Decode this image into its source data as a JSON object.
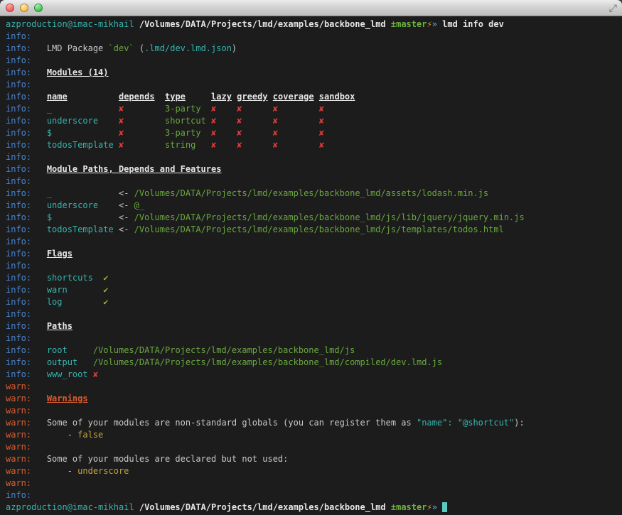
{
  "window": {
    "title": "",
    "titlebar_buttons": [
      {
        "name": "close-button"
      },
      {
        "name": "minimize-button"
      },
      {
        "name": "zoom-button"
      }
    ],
    "resize_icon": "⤢"
  },
  "colors": {
    "bg": "#1c1c1c",
    "info": "#4a85d1",
    "warn": "#dc5c2e",
    "teal": "#36b3ae",
    "green": "#69a83e",
    "check": "#93b43a",
    "red": "#dd3d3a",
    "yellow": "#c2a33a",
    "white": "#c9c9c9",
    "bright": "#e6e6e6",
    "branch": "#6db43f",
    "bolt": "#e2a43c",
    "arrow": "#46a0d0",
    "cursor": "#5bc8c2"
  },
  "terminal": {
    "lines": [
      {
        "name": "prompt-line",
        "segments": [
          {
            "t": "azproduction@imac-mikhail",
            "c": "teal",
            "n": "prompt-user-host"
          },
          {
            "t": " "
          },
          {
            "t": "/Volumes/DATA/Projects/lmd/examples/backbone_lmd",
            "c": "bright",
            "b": true,
            "n": "prompt-cwd"
          },
          {
            "t": " "
          },
          {
            "t": "±master",
            "c": "branch",
            "b": true,
            "n": "git-branch"
          },
          {
            "t": "⚡",
            "c": "bolt",
            "n": "git-dirty-icon"
          },
          {
            "t": "»",
            "c": "arrow",
            "b": true,
            "n": "prompt-arrow"
          },
          {
            "t": " "
          },
          {
            "t": "lmd info dev",
            "c": "bright",
            "b": true,
            "n": "command"
          }
        ]
      },
      {
        "name": "output-line",
        "segments": [
          {
            "t": "info:",
            "c": "info"
          }
        ]
      },
      {
        "name": "output-line",
        "segments": [
          {
            "t": "info:",
            "c": "info"
          },
          {
            "t": "   "
          },
          {
            "t": "LMD Package "
          },
          {
            "t": "`dev`",
            "c": "green"
          },
          {
            "t": " ("
          },
          {
            "t": ".lmd/dev.lmd.json",
            "c": "teal"
          },
          {
            "t": ")"
          }
        ]
      },
      {
        "name": "output-line",
        "segments": [
          {
            "t": "info:",
            "c": "info"
          }
        ]
      },
      {
        "name": "output-line",
        "segments": [
          {
            "t": "info:",
            "c": "info"
          },
          {
            "t": "   "
          },
          {
            "t": "Modules (14)",
            "c": "bright",
            "u": true,
            "b": true,
            "n": "section-modules"
          }
        ]
      },
      {
        "name": "output-line",
        "segments": [
          {
            "t": "info:",
            "c": "info"
          }
        ]
      },
      {
        "name": "output-line",
        "segments": [
          {
            "t": "info:",
            "c": "info"
          },
          {
            "t": "   "
          },
          {
            "t": "name",
            "c": "bright",
            "u": true,
            "b": true
          },
          {
            "t": "          "
          },
          {
            "t": "depends",
            "c": "bright",
            "u": true,
            "b": true
          },
          {
            "t": "  "
          },
          {
            "t": "type",
            "c": "bright",
            "u": true,
            "b": true
          },
          {
            "t": "     "
          },
          {
            "t": "lazy",
            "c": "bright",
            "u": true,
            "b": true
          },
          {
            "t": " "
          },
          {
            "t": "greedy",
            "c": "bright",
            "u": true,
            "b": true
          },
          {
            "t": " "
          },
          {
            "t": "coverage",
            "c": "bright",
            "u": true,
            "b": true
          },
          {
            "t": " "
          },
          {
            "t": "sandbox",
            "c": "bright",
            "u": true,
            "b": true
          }
        ]
      },
      {
        "name": "output-line",
        "segments": [
          {
            "t": "info:",
            "c": "info"
          },
          {
            "t": "   "
          },
          {
            "t": "_             ",
            "c": "teal"
          },
          {
            "t": "✘",
            "c": "red"
          },
          {
            "t": "        "
          },
          {
            "t": "3-party",
            "c": "green"
          },
          {
            "t": "  "
          },
          {
            "t": "✘",
            "c": "red"
          },
          {
            "t": "    "
          },
          {
            "t": "✘",
            "c": "red"
          },
          {
            "t": "      "
          },
          {
            "t": "✘",
            "c": "red"
          },
          {
            "t": "        "
          },
          {
            "t": "✘",
            "c": "red"
          }
        ]
      },
      {
        "name": "output-line",
        "segments": [
          {
            "t": "info:",
            "c": "info"
          },
          {
            "t": "   "
          },
          {
            "t": "underscore    ",
            "c": "teal"
          },
          {
            "t": "✘",
            "c": "red"
          },
          {
            "t": "        "
          },
          {
            "t": "shortcut",
            "c": "green"
          },
          {
            "t": " "
          },
          {
            "t": "✘",
            "c": "red"
          },
          {
            "t": "    "
          },
          {
            "t": "✘",
            "c": "red"
          },
          {
            "t": "      "
          },
          {
            "t": "✘",
            "c": "red"
          },
          {
            "t": "        "
          },
          {
            "t": "✘",
            "c": "red"
          }
        ]
      },
      {
        "name": "output-line",
        "segments": [
          {
            "t": "info:",
            "c": "info"
          },
          {
            "t": "   "
          },
          {
            "t": "$             ",
            "c": "teal"
          },
          {
            "t": "✘",
            "c": "red"
          },
          {
            "t": "        "
          },
          {
            "t": "3-party",
            "c": "green"
          },
          {
            "t": "  "
          },
          {
            "t": "✘",
            "c": "red"
          },
          {
            "t": "    "
          },
          {
            "t": "✘",
            "c": "red"
          },
          {
            "t": "      "
          },
          {
            "t": "✘",
            "c": "red"
          },
          {
            "t": "        "
          },
          {
            "t": "✘",
            "c": "red"
          }
        ]
      },
      {
        "name": "output-line",
        "segments": [
          {
            "t": "info:",
            "c": "info"
          },
          {
            "t": "   "
          },
          {
            "t": "todosTemplate ",
            "c": "teal"
          },
          {
            "t": "✘",
            "c": "red"
          },
          {
            "t": "        "
          },
          {
            "t": "string",
            "c": "green"
          },
          {
            "t": "   "
          },
          {
            "t": "✘",
            "c": "red"
          },
          {
            "t": "    "
          },
          {
            "t": "✘",
            "c": "red"
          },
          {
            "t": "      "
          },
          {
            "t": "✘",
            "c": "red"
          },
          {
            "t": "        "
          },
          {
            "t": "✘",
            "c": "red"
          }
        ]
      },
      {
        "name": "output-line",
        "segments": [
          {
            "t": "info:",
            "c": "info"
          }
        ]
      },
      {
        "name": "output-line",
        "segments": [
          {
            "t": "info:",
            "c": "info"
          },
          {
            "t": "   "
          },
          {
            "t": "Module Paths, Depends and Features",
            "c": "bright",
            "u": true,
            "b": true,
            "n": "section-module-paths"
          }
        ]
      },
      {
        "name": "output-line",
        "segments": [
          {
            "t": "info:",
            "c": "info"
          }
        ]
      },
      {
        "name": "output-line",
        "segments": [
          {
            "t": "info:",
            "c": "info"
          },
          {
            "t": "   "
          },
          {
            "t": "_             ",
            "c": "teal"
          },
          {
            "t": "<- "
          },
          {
            "t": "/Volumes/DATA/Projects/lmd/examples/backbone_lmd/assets/lodash.min.js",
            "c": "green"
          }
        ]
      },
      {
        "name": "output-line",
        "segments": [
          {
            "t": "info:",
            "c": "info"
          },
          {
            "t": "   "
          },
          {
            "t": "underscore    ",
            "c": "teal"
          },
          {
            "t": "<- "
          },
          {
            "t": "@_",
            "c": "green"
          }
        ]
      },
      {
        "name": "output-line",
        "segments": [
          {
            "t": "info:",
            "c": "info"
          },
          {
            "t": "   "
          },
          {
            "t": "$             ",
            "c": "teal"
          },
          {
            "t": "<- "
          },
          {
            "t": "/Volumes/DATA/Projects/lmd/examples/backbone_lmd/js/lib/jquery/jquery.min.js",
            "c": "green"
          }
        ]
      },
      {
        "name": "output-line",
        "segments": [
          {
            "t": "info:",
            "c": "info"
          },
          {
            "t": "   "
          },
          {
            "t": "todosTemplate ",
            "c": "teal"
          },
          {
            "t": "<- "
          },
          {
            "t": "/Volumes/DATA/Projects/lmd/examples/backbone_lmd/js/templates/todos.html",
            "c": "green"
          }
        ]
      },
      {
        "name": "output-line",
        "segments": [
          {
            "t": "info:",
            "c": "info"
          }
        ]
      },
      {
        "name": "output-line",
        "segments": [
          {
            "t": "info:",
            "c": "info"
          },
          {
            "t": "   "
          },
          {
            "t": "Flags",
            "c": "bright",
            "u": true,
            "b": true,
            "n": "section-flags"
          }
        ]
      },
      {
        "name": "output-line",
        "segments": [
          {
            "t": "info:",
            "c": "info"
          }
        ]
      },
      {
        "name": "output-line",
        "segments": [
          {
            "t": "info:",
            "c": "info"
          },
          {
            "t": "   "
          },
          {
            "t": "shortcuts  ",
            "c": "teal"
          },
          {
            "t": "✔",
            "c": "check"
          }
        ]
      },
      {
        "name": "output-line",
        "segments": [
          {
            "t": "info:",
            "c": "info"
          },
          {
            "t": "   "
          },
          {
            "t": "warn       ",
            "c": "teal"
          },
          {
            "t": "✔",
            "c": "check"
          }
        ]
      },
      {
        "name": "output-line",
        "segments": [
          {
            "t": "info:",
            "c": "info"
          },
          {
            "t": "   "
          },
          {
            "t": "log        ",
            "c": "teal"
          },
          {
            "t": "✔",
            "c": "check"
          }
        ]
      },
      {
        "name": "output-line",
        "segments": [
          {
            "t": "info:",
            "c": "info"
          }
        ]
      },
      {
        "name": "output-line",
        "segments": [
          {
            "t": "info:",
            "c": "info"
          },
          {
            "t": "   "
          },
          {
            "t": "Paths",
            "c": "bright",
            "u": true,
            "b": true,
            "n": "section-paths"
          }
        ]
      },
      {
        "name": "output-line",
        "segments": [
          {
            "t": "info:",
            "c": "info"
          }
        ]
      },
      {
        "name": "output-line",
        "segments": [
          {
            "t": "info:",
            "c": "info"
          },
          {
            "t": "   "
          },
          {
            "t": "root     ",
            "c": "teal"
          },
          {
            "t": "/Volumes/DATA/Projects/lmd/examples/backbone_lmd/js",
            "c": "green"
          }
        ]
      },
      {
        "name": "output-line",
        "segments": [
          {
            "t": "info:",
            "c": "info"
          },
          {
            "t": "   "
          },
          {
            "t": "output   ",
            "c": "teal"
          },
          {
            "t": "/Volumes/DATA/Projects/lmd/examples/backbone_lmd/compiled/dev.lmd.js",
            "c": "green"
          }
        ]
      },
      {
        "name": "output-line",
        "segments": [
          {
            "t": "info:",
            "c": "info"
          },
          {
            "t": "   "
          },
          {
            "t": "www_root ",
            "c": "teal"
          },
          {
            "t": "✘",
            "c": "red"
          }
        ]
      },
      {
        "name": "output-line",
        "segments": [
          {
            "t": "warn:",
            "c": "warn"
          }
        ]
      },
      {
        "name": "output-line",
        "segments": [
          {
            "t": "warn:",
            "c": "warn"
          },
          {
            "t": "   "
          },
          {
            "t": "Warnings",
            "c": "warn",
            "u": true,
            "b": true,
            "n": "section-warnings"
          }
        ]
      },
      {
        "name": "output-line",
        "segments": [
          {
            "t": "warn:",
            "c": "warn"
          }
        ]
      },
      {
        "name": "output-line",
        "segments": [
          {
            "t": "warn:",
            "c": "warn"
          },
          {
            "t": "   "
          },
          {
            "t": "Some of your modules are non-standard globals (you can register them as "
          },
          {
            "t": "\"name\": \"@shortcut\"",
            "c": "teal"
          },
          {
            "t": "):"
          }
        ]
      },
      {
        "name": "output-line",
        "segments": [
          {
            "t": "warn:",
            "c": "warn"
          },
          {
            "t": "       - "
          },
          {
            "t": "false",
            "c": "yellow"
          }
        ]
      },
      {
        "name": "output-line",
        "segments": [
          {
            "t": "warn:",
            "c": "warn"
          }
        ]
      },
      {
        "name": "output-line",
        "segments": [
          {
            "t": "warn:",
            "c": "warn"
          },
          {
            "t": "   "
          },
          {
            "t": "Some of your modules are declared but not used:"
          }
        ]
      },
      {
        "name": "output-line",
        "segments": [
          {
            "t": "warn:",
            "c": "warn"
          },
          {
            "t": "       - "
          },
          {
            "t": "underscore",
            "c": "yellow"
          }
        ]
      },
      {
        "name": "output-line",
        "segments": [
          {
            "t": "warn:",
            "c": "warn"
          }
        ]
      },
      {
        "name": "output-line",
        "segments": [
          {
            "t": "info:",
            "c": "info"
          }
        ]
      },
      {
        "name": "prompt-line",
        "segments": [
          {
            "t": "azproduction@imac-mikhail",
            "c": "teal",
            "n": "prompt-user-host"
          },
          {
            "t": " "
          },
          {
            "t": "/Volumes/DATA/Projects/lmd/examples/backbone_lmd",
            "c": "bright",
            "b": true,
            "n": "prompt-cwd"
          },
          {
            "t": " "
          },
          {
            "t": "±master",
            "c": "branch",
            "b": true,
            "n": "git-branch"
          },
          {
            "t": "⚡",
            "c": "bolt",
            "n": "git-dirty-icon"
          },
          {
            "t": "»",
            "c": "arrow",
            "b": true,
            "n": "prompt-arrow"
          },
          {
            "t": " "
          },
          {
            "t": " ",
            "cursor": true,
            "n": "cursor"
          }
        ]
      }
    ]
  }
}
